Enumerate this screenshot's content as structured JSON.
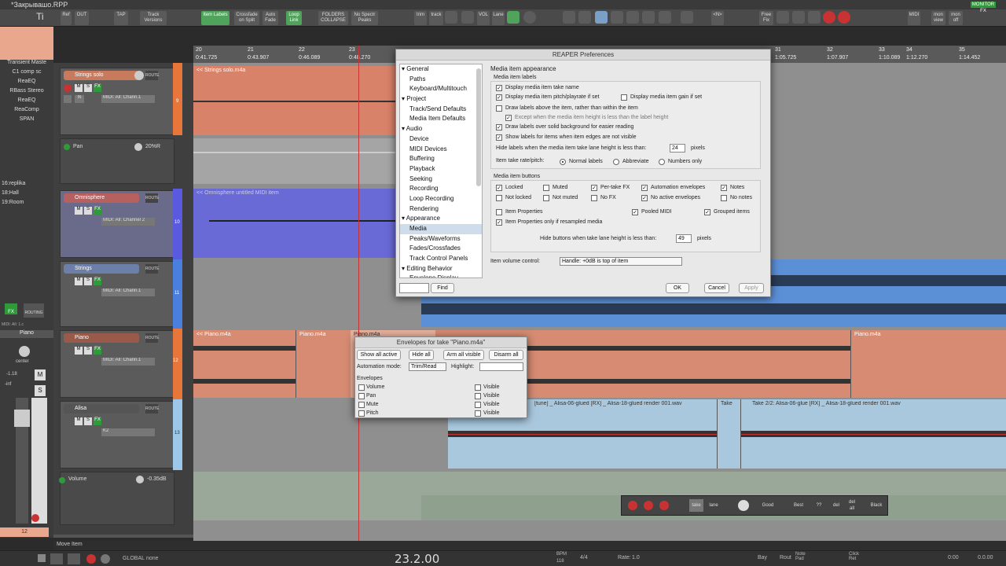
{
  "window": {
    "title": "*Закрывашо.RPP"
  },
  "toolbar": {
    "buttons": [
      "Ref",
      "OUT",
      "TAP",
      "Track Versions",
      "Item Labels",
      "Crossfade on Split",
      "Auto Fade",
      "Loop Link",
      "FOLDERS COLLAPSE",
      "No Spectr Peaks",
      "trim",
      "track",
      "VOL",
      "Lane",
      "<N>",
      "Free Fix",
      "MIDI",
      "mon view",
      "mon off"
    ],
    "monitor_label": "MONITOR FX"
  },
  "left_fx": [
    "Transient Maste",
    "C1 comp sc",
    "ReaEQ",
    "RBass Stereo",
    "ReaEQ",
    "ReaComp",
    "SPAN"
  ],
  "left_presets": [
    "16:replika",
    "18:Hall",
    "19:Room"
  ],
  "master": {
    "label": "Piano",
    "pan_label": "center",
    "db_a": "-1.18",
    "db_b": "-inf",
    "num": "12",
    "fx": "FX",
    "routing": "ROUTING",
    "mi": "MIDI: All: 1.c",
    "m": "M",
    "s": "S"
  },
  "tracks": [
    {
      "name": "Strings solo",
      "color": "#d9755a",
      "strip": "#e8763a",
      "num": "9",
      "input": "MIDI: All: Chann.1",
      "route": "ROUTE"
    },
    {
      "name": "Pan",
      "value": "20%R",
      "env": true
    },
    {
      "name": "Omnisphere",
      "color": "#6e6ec7",
      "strip": "#5a5ae0",
      "num": "10",
      "input": "MIDI: All: Channel 2",
      "route": "ROUTE"
    },
    {
      "name": "Strings",
      "color": "#6b7fa8",
      "strip": "#4a7fe0",
      "num": "11",
      "input": "MIDI: All: Chann.1",
      "route": "ROUTE"
    },
    {
      "name": "Piano",
      "color": "#c9705a",
      "strip": "#e8763a",
      "num": "12",
      "input": "MIDI: All: Chann.1",
      "route": "ROUTE"
    },
    {
      "name": "Alisa",
      "color": "#7a9ab5",
      "strip": "#9cc7e8",
      "num": "13",
      "input": "K2",
      "route": "ROUTE"
    },
    {
      "name": "Volume",
      "value": "-0.35dB",
      "env": true
    }
  ],
  "track_buttons": {
    "m": "M",
    "s": "S",
    "fx": "FX",
    "in": "IN",
    "trim": "trim"
  },
  "ruler": {
    "ticks": [
      {
        "bar": "20",
        "time": "0:41.725"
      },
      {
        "bar": "21",
        "time": "0:43.907"
      },
      {
        "bar": "22",
        "time": "0:46.089"
      },
      {
        "bar": "23",
        "time": "0:48.270"
      },
      {
        "bar": "31",
        "time": "1:05.725"
      },
      {
        "bar": "32",
        "time": "1:07.907"
      },
      {
        "bar": "33",
        "time": "1:10.089"
      },
      {
        "bar": "34",
        "time": "1:12.270"
      },
      {
        "bar": "35",
        "time": "1:14.452"
      }
    ]
  },
  "items": {
    "strings_solo": "<< Strings solo.m4a",
    "omnisphere": "<< Omnisphere untitled MIDI item",
    "piano_a": "<< Piano.m4a",
    "piano_b": "Piano.m4a",
    "piano_c": "Piano.m4a",
    "piano_d": "Piano.m4a",
    "alisa_a": "[tune] _ Alisa-06-glued [RX] _ Alisa-18-glued render 001.wav",
    "alisa_b": "Take",
    "alisa_c": "Take 2/2: Alisa-06-glue [RX] _ Alisa-18-glued render 001.wav"
  },
  "prefs": {
    "title": "REAPER Preferences",
    "tree": [
      {
        "label": "General",
        "level": 0,
        "arrow": true
      },
      {
        "label": "Paths",
        "level": 1
      },
      {
        "label": "Keyboard/Multitouch",
        "level": 1
      },
      {
        "label": "Project",
        "level": 0,
        "arrow": true
      },
      {
        "label": "Track/Send Defaults",
        "level": 1
      },
      {
        "label": "Media Item Defaults",
        "level": 1
      },
      {
        "label": "Audio",
        "level": 0,
        "arrow": true
      },
      {
        "label": "Device",
        "level": 1
      },
      {
        "label": "MIDI Devices",
        "level": 1
      },
      {
        "label": "Buffering",
        "level": 1
      },
      {
        "label": "Playback",
        "level": 1
      },
      {
        "label": "Seeking",
        "level": 1
      },
      {
        "label": "Recording",
        "level": 1
      },
      {
        "label": "Loop Recording",
        "level": 1
      },
      {
        "label": "Rendering",
        "level": 1
      },
      {
        "label": "Appearance",
        "level": 0,
        "arrow": true
      },
      {
        "label": "Media",
        "level": 1,
        "selected": true
      },
      {
        "label": "Peaks/Waveforms",
        "level": 1
      },
      {
        "label": "Fades/Crossfades",
        "level": 1
      },
      {
        "label": "Track Control Panels",
        "level": 1
      },
      {
        "label": "Editing Behavior",
        "level": 0,
        "arrow": true
      },
      {
        "label": "Envelope Display",
        "level": 1
      }
    ],
    "section_title": "Media item appearance",
    "labels_group": "Media item labels",
    "opts": {
      "take_name": "Display media item take name",
      "pitch_rate": "Display media item pitch/playrate if set",
      "gain": "Display media item gain if set",
      "above": "Draw labels above the item, rather than within the item",
      "except": "Except when the media item height is less than the label height",
      "solid_bg": "Draw labels over solid background for easier reading",
      "edges": "Show labels for items when item edges are not visible",
      "hide_lane_label": "Hide labels when the media item take lane height is less than:",
      "hide_lane_val": "24",
      "pixels": "pixels",
      "rate_label": "Item take rate/pitch:",
      "rate_normal": "Normal labels",
      "rate_abbrev": "Abbreviate",
      "rate_numbers": "Numbers only"
    },
    "buttons_group": "Media item buttons",
    "btn_opts": [
      "Locked",
      "Muted",
      "Per-take FX",
      "Automation envelopes",
      "Notes",
      "Not locked",
      "Not muted",
      "No FX",
      "No active envelopes",
      "No notes",
      "Item Properties",
      "Pooled MIDI",
      "Grouped items",
      "Item Properties only if resampled media"
    ],
    "hide_buttons_label": "Hide buttons when take lane height is less than:",
    "hide_buttons_val": "49",
    "vol_label": "Item volume control:",
    "vol_value": "Handle: +0dB is top of item",
    "find_label": "Find",
    "ok": "OK",
    "cancel": "Cancel",
    "apply": "Apply"
  },
  "env_dialog": {
    "title": "Envelopes for take \"Piano.m4a\"",
    "show_all": "Show all active",
    "hide_all": "Hide all",
    "arm_all": "Arm all visible",
    "disarm_all": "Disarm all",
    "mode_label": "Automation mode:",
    "mode_value": "Trim/Read",
    "highlight_label": "Highlight:",
    "env_header": "Envelopes",
    "envelopes": [
      "Volume",
      "Pan",
      "Mute",
      "Pitch"
    ],
    "visible": "Visible"
  },
  "take_toolbar": {
    "take": "take",
    "lane": "lane",
    "good": "Good",
    "best": "Best",
    "q": "??",
    "del": "del",
    "delall": "del all",
    "black": "Black"
  },
  "status": {
    "action": "Move Item"
  },
  "transport": {
    "position": "23.2.00",
    "bpm_label": "BPM",
    "bpm": "118",
    "sig": "4/4",
    "rate_label": "Rate:",
    "rate": "1.0",
    "global": "GLOBAL",
    "none": "none",
    "out_time": "0:00",
    "out_val": "0.0.00",
    "right_buttons": [
      "Bay",
      "Rout",
      "Note Pad",
      "Click Ret"
    ]
  },
  "colors": {
    "orange": "#d9755a",
    "blue": "#5a5ae0",
    "piano": "#d68b72",
    "alisa": "#a9c8de",
    "green": "#4fa35a"
  }
}
